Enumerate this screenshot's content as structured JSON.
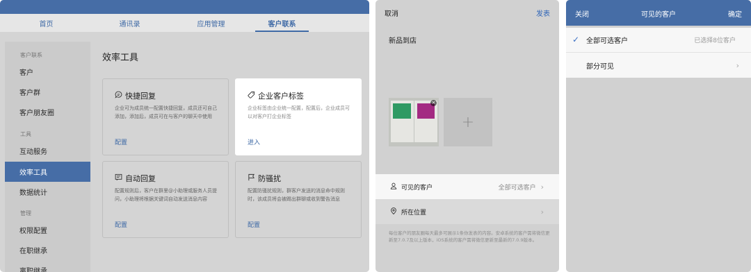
{
  "console": {
    "tabs": [
      "首页",
      "通讯录",
      "应用管理",
      "客户联系"
    ],
    "active_tab": "客户联系",
    "sidebar": {
      "section_customer": "客户联系",
      "customer_items": [
        "客户",
        "客户群",
        "客户朋友圈"
      ],
      "section_tools": "工具",
      "tool_items": [
        "互动服务",
        "效率工具",
        "数据统计"
      ],
      "section_admin": "管理",
      "admin_items": [
        "权限配置",
        "在职继承",
        "离职继承"
      ],
      "active_item": "效率工具"
    },
    "main_title": "效率工具",
    "cards": [
      {
        "title": "快捷回复",
        "icon": "chat-bubble-icon",
        "desc": "企业可为成员统一配置快捷回复，成员还可自己添加，添加后，成员可在与客户的聊天中使用",
        "action": "配置"
      },
      {
        "title": "企业客户标签",
        "icon": "tag-icon",
        "desc": "企业标签由企业统一配置，配置后，企业成员可以对客户打企业标签",
        "action": "进入"
      },
      {
        "title": "自动回复",
        "icon": "auto-reply-icon",
        "desc": "配置规则后，客户在群里@小助理或服务人员提问，小助理将根据关键词自动发送消息内容",
        "action": "配置"
      },
      {
        "title": "防骚扰",
        "icon": "flag-icon",
        "desc": "配置防骚扰规则，群客户发送的消息命中规则时，该成员将会被踢出群聊或收到警告消息",
        "action": "配置"
      }
    ]
  },
  "compose": {
    "cancel": "取消",
    "publish": "发表",
    "post_text": "新品到店",
    "add_photo_symbol": "+",
    "visible_label": "可见的客户",
    "visible_value": "全部可选客户",
    "location_label": "所在位置",
    "footnote": "每位客户的朋友圈每天最多可展示1条你发表的内容。安卓系统的客户需将微信更新至7.0.7及以上版本，iOS系统的客户需将微信更新至最新的7.0.9版本。"
  },
  "visibility": {
    "close": "关闭",
    "title": "可见的客户",
    "confirm": "确定",
    "option_all": "全部可选客户",
    "option_all_note": "已选择8位客户",
    "option_partial": "部分可见"
  },
  "colors": {
    "brand_blue": "#466da6",
    "link_blue": "#3f6aa6",
    "check_blue": "#3a6fc4"
  }
}
